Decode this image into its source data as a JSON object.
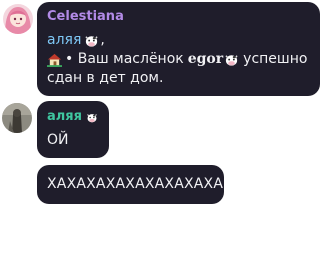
{
  "messages": [
    {
      "sender": "Celestiana",
      "sender_color": "#b28ae6",
      "reply_to": "аляя",
      "reply_suffix": ",",
      "body_prefix": "• Ваш маслёнок",
      "body_name": "egor",
      "body_suffix": "успешно",
      "body_line2": "сдан в дет дом.",
      "icons": [
        "cow-emoji",
        "house-emoji",
        "cow-emoji"
      ]
    },
    {
      "sender": "аляя",
      "sender_color": "#3fc6a0",
      "text": "ОЙ",
      "icons": [
        "cow-emoji"
      ]
    },
    {
      "text": "ХАХАХАХАХАХАХАХАХА"
    }
  ],
  "colors": {
    "bubble_bg": "#1f1d2b",
    "text": "#f1f1f4",
    "mention": "#7ec7f5"
  }
}
